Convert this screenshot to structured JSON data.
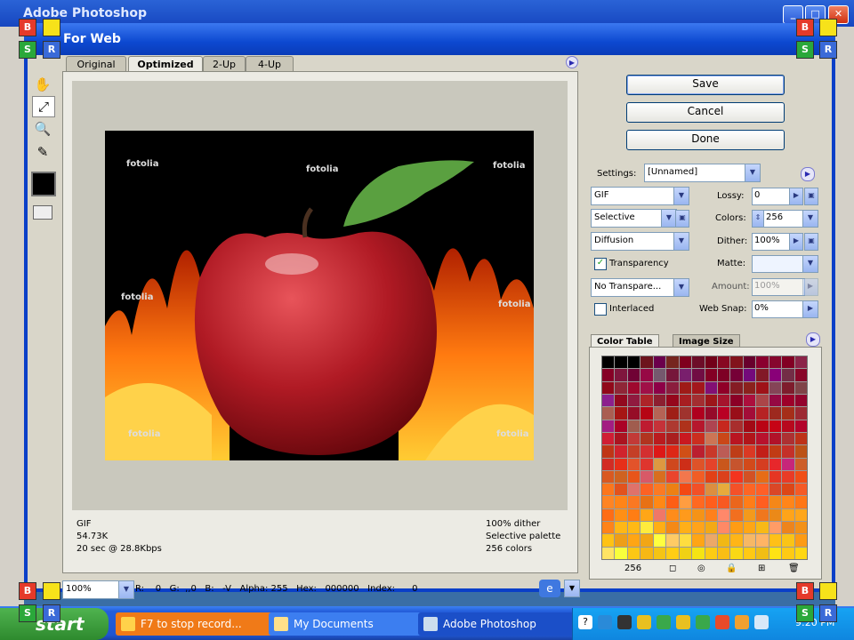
{
  "app": {
    "title": "Adobe Photoshop"
  },
  "dialog": {
    "title": "For Web"
  },
  "tabs": [
    "Original",
    "Optimized",
    "2-Up",
    "4-Up"
  ],
  "image": {
    "watermarks": [
      "fotolia",
      "fotolia",
      "fotolia",
      "fotolia",
      "fotolia",
      "fotolia",
      "fotolia"
    ]
  },
  "info_left": [
    "GIF",
    "54.73K",
    "20 sec @ 28.8Kbps"
  ],
  "info_right": [
    "100% dither",
    "Selective palette",
    "256 colors"
  ],
  "status_bar": {
    "zoom": "100%",
    "values": "R:    0   G:  ,,0   B:   -V   Alpha: 255   Hex:   000000   Index:      0"
  },
  "buttons": {
    "save": "Save",
    "cancel": "Cancel",
    "done": "Done"
  },
  "settings": {
    "label": "Settings:",
    "preset": "[Unnamed]",
    "format": "GIF",
    "palette": "Selective",
    "dither_algo": "Diffusion",
    "transparency_label": "Transparency",
    "transparency_checked": true,
    "no_transparency_dither": "No Transpare...",
    "interlaced_label": "Interlaced",
    "interlaced_checked": false,
    "lossy_label": "Lossy:",
    "lossy": "0",
    "colors_label": "Colors:",
    "colors": "256",
    "dither_label": "Dither:",
    "dither": "100%",
    "matte_label": "Matte:",
    "matte": "",
    "amount_label": "Amount:",
    "amount": "100%",
    "web_snap_label": "Web Snap:",
    "web_snap": "0%"
  },
  "panel_tabs": [
    "Color Table",
    "Image Size"
  ],
  "color_table": {
    "count": "256"
  },
  "colors": {
    "accent": "#0a3fc8",
    "dialog_bg": "#d9d6c9"
  },
  "taskbar": {
    "start": "start",
    "tasks": [
      "F7 to stop record...",
      "My Documents",
      "Adobe Photoshop"
    ],
    "clock": "9:20 PM"
  },
  "overlay_letters": [
    "B",
    "S",
    "R"
  ]
}
